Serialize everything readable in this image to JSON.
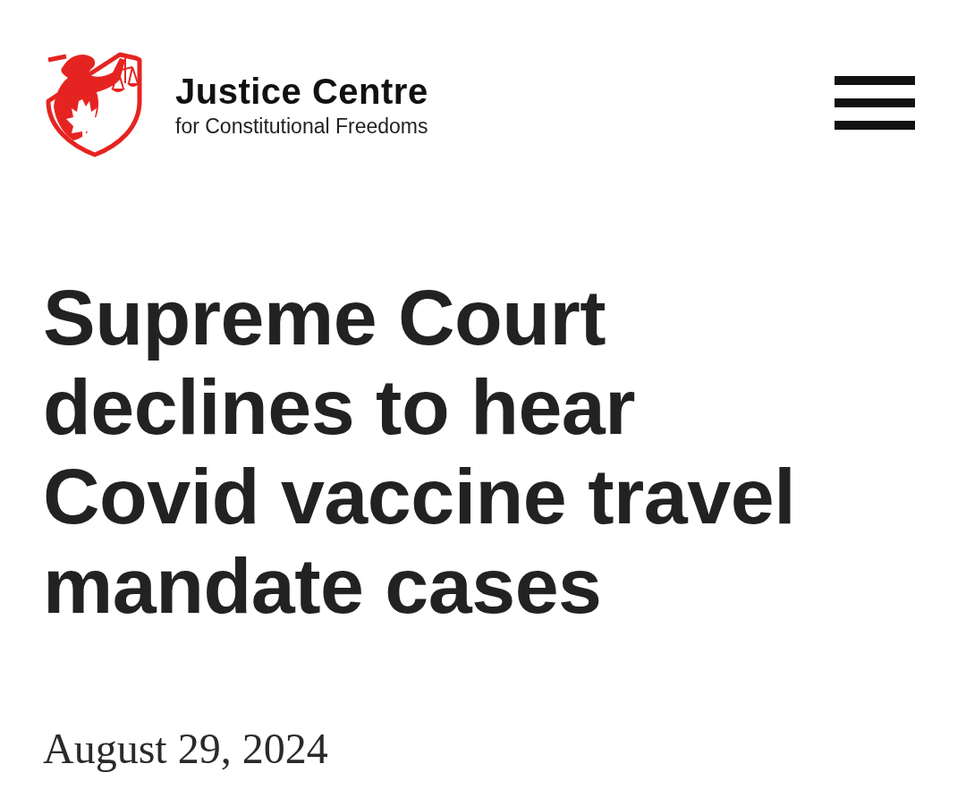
{
  "header": {
    "brand_name": "Justice Centre",
    "brand_tagline": "for Constitutional Freedoms"
  },
  "article": {
    "title": "Supreme Court declines to hear Covid vaccine travel mandate cases",
    "date": "August 29, 2024"
  }
}
